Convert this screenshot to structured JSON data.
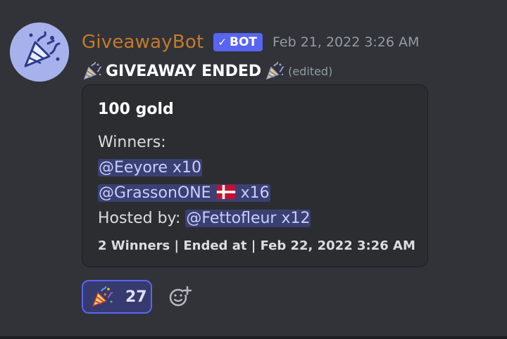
{
  "message": {
    "author": "GiveawayBot",
    "bot_tag": "BOT",
    "bot_check_icon": "check-icon",
    "timestamp": "Feb 21, 2022 3:26 AM",
    "title": "GIVEAWAY ENDED",
    "title_emoji": "party-popper-icon",
    "edited": "(edited)",
    "username_color": "#c47a2c"
  },
  "embed": {
    "title": "100 gold",
    "winners_label": "Winners:",
    "winners": [
      {
        "mention": "@Eeyore x10"
      },
      {
        "mention": "@GrassonONE",
        "flag": "denmark-flag-icon",
        "suffix": "x16"
      }
    ],
    "hosted_by_label": "Hosted by:",
    "host": "@Fettofleur x12",
    "footer": "2 Winners | Ended at | Feb 22, 2022 3:26 AM"
  },
  "reactions": [
    {
      "emoji": "party-popper-icon",
      "count": "27",
      "reacted": true
    }
  ],
  "add_reaction_icon": "add-reaction-icon",
  "colors": {
    "background": "#313338",
    "embed_bg": "#2b2d31",
    "accent": "#5865f2",
    "mention_bg": "rgba(88,101,242,0.35)"
  }
}
